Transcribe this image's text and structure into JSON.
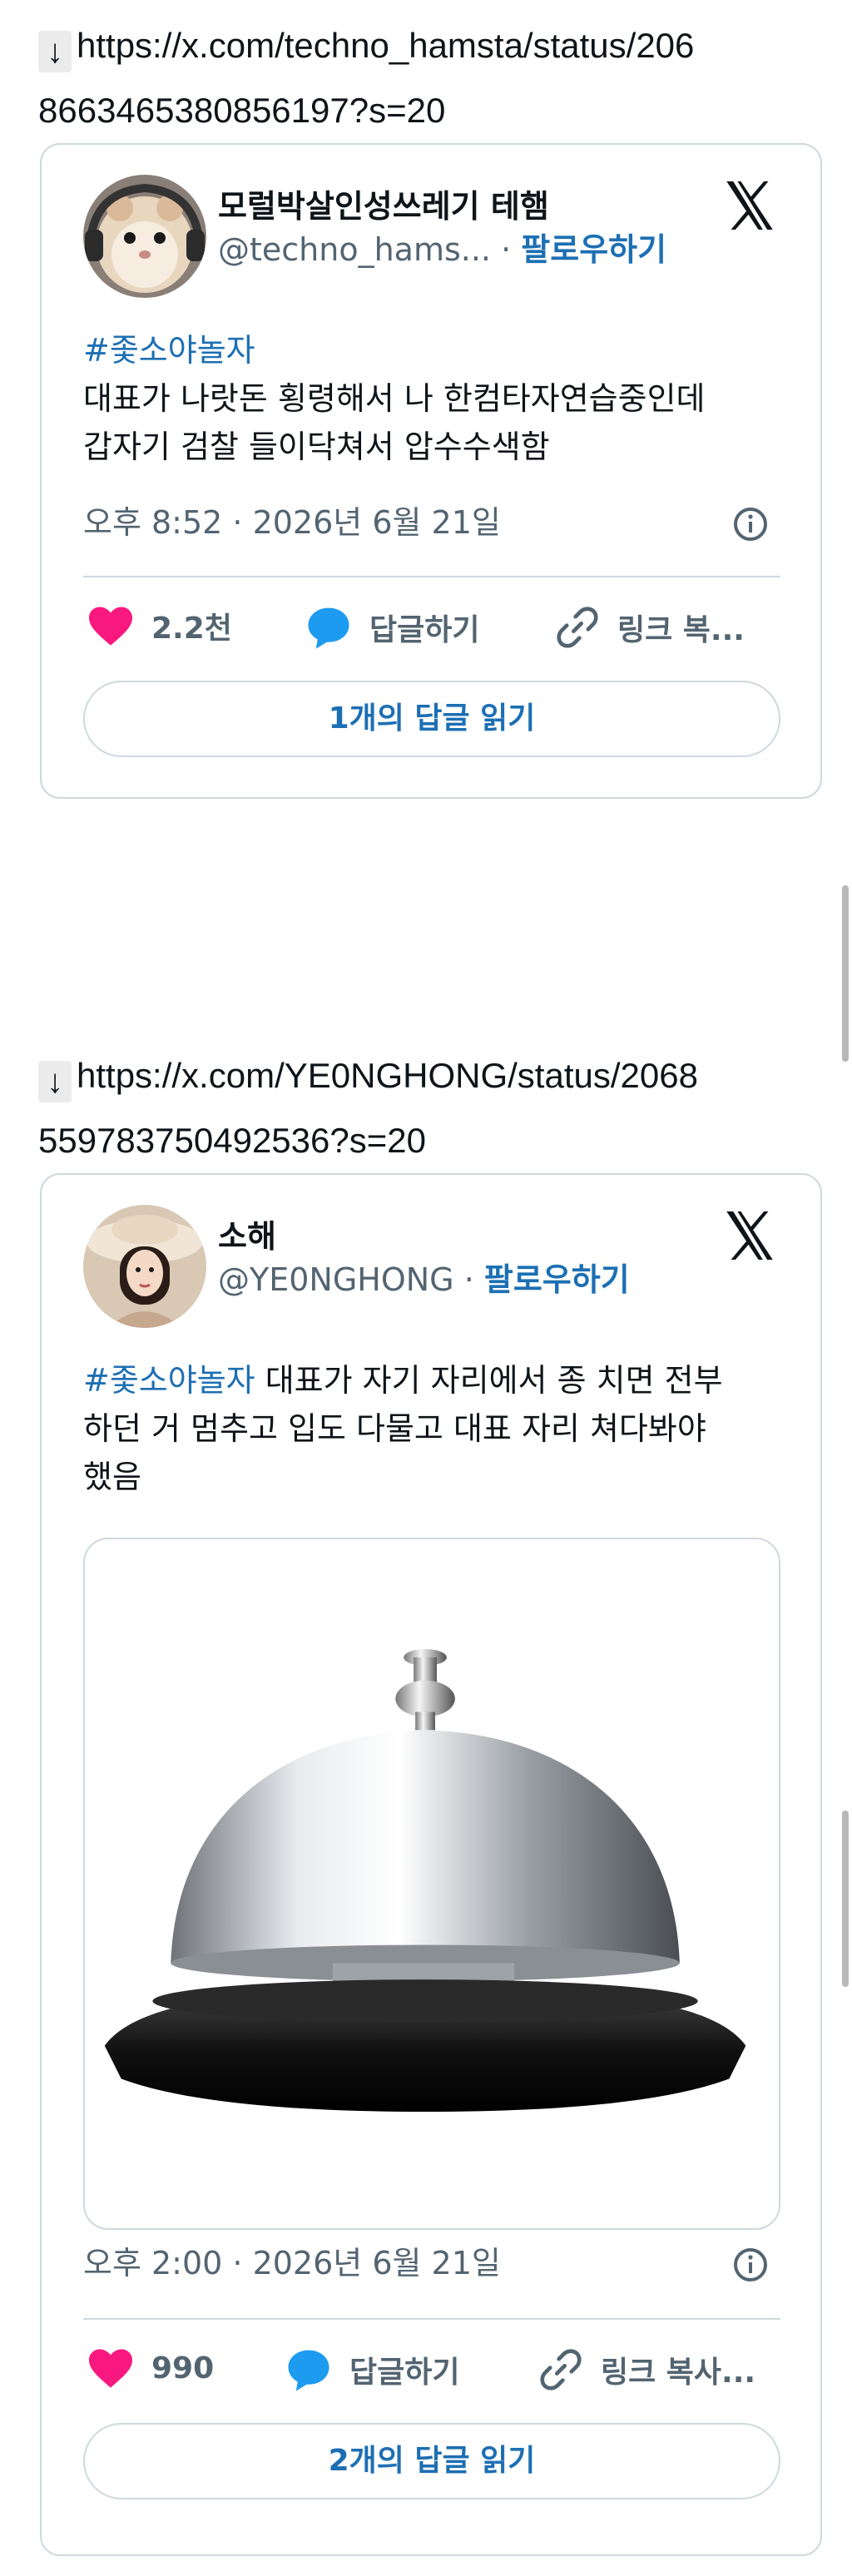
{
  "posts": [
    {
      "url_line1": "https://x.com/techno_hamsta/status/206",
      "url_line2": "8663465380856197?s=20",
      "author_name": "모럴박살인성쓰레기 테햄",
      "handle": "@techno_hams...",
      "follow_label": "팔로우하기",
      "hashtag": "#좇소야놀자",
      "text_line1": "대표가 나랏돈 횡령해서 나 한컴타자연습중인데",
      "text_line2": "갑자기 검찰 들이닥쳐서 압수수색함",
      "timestamp": "오후 8:52 · 2026년 6월 21일",
      "likes": "2.2천",
      "reply_label": "답글하기",
      "copy_label": "링크 복...",
      "read_replies": "1개의 답글 읽기",
      "like_color": "#f91880"
    },
    {
      "url_line1": "https://x.com/YE0NGHONG/status/2068",
      "url_line2": "559783750492536?s=20",
      "author_name": "소해",
      "handle": "@YE0NGHONG",
      "follow_label": "팔로우하기",
      "hashtag": "#좇소야놀자",
      "text_line1_rest": " 대표가 자기 자리에서 종 치면 전부",
      "text_line2": "하던 거 멈추고 입도 다물고 대표 자리 쳐다봐야",
      "text_line3": "했음",
      "media_icon": "service-bell-image",
      "timestamp": "오후 2:00 · 2026년 6월 21일",
      "likes": "990",
      "reply_label": "답글하기",
      "copy_label": "링크 복사...",
      "read_replies": "2개의 답글 읽기",
      "like_color": "#f91880"
    }
  ],
  "arrow_glyph": "↓",
  "accent": "#1d6fb3"
}
